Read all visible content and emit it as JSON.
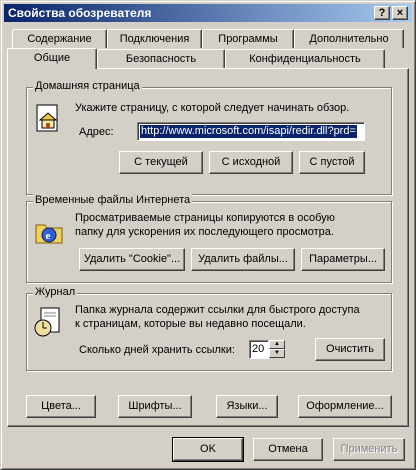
{
  "window": {
    "title": "Свойства обозревателя",
    "help": "?",
    "close": "×"
  },
  "tabs": {
    "row1": [
      "Содержание",
      "Подключения",
      "Программы",
      "Дополнительно"
    ],
    "row2": [
      "Общие",
      "Безопасность",
      "Конфиденциальность"
    ]
  },
  "home": {
    "legend": "Домашняя страница",
    "desc": "Укажите страницу, с которой следует начинать обзор.",
    "address_label": "Адрес:",
    "address_value": "http://www.microsoft.com/isapi/redir.dll?prd=",
    "btn_current": "С текущей",
    "btn_default": "С исходной",
    "btn_blank": "С пустой"
  },
  "temp": {
    "legend": "Временные файлы Интернета",
    "desc1": "Просматриваемые страницы копируются в особую",
    "desc2": "папку для ускорения их последующего просмотра.",
    "btn_cookies": "Удалить \"Cookie\"...",
    "btn_files": "Удалить файлы...",
    "btn_settings": "Параметры..."
  },
  "history": {
    "legend": "Журнал",
    "desc1": "Папка журнала содержит ссылки для быстрого доступа",
    "desc2": "к страницам, которые вы недавно посещали.",
    "days_label": "Сколько дней хранить ссылки:",
    "days_value": "20",
    "btn_clear": "Очистить"
  },
  "bottom": {
    "colors": "Цвета...",
    "fonts": "Шрифты...",
    "languages": "Языки...",
    "design": "Оформление..."
  },
  "dialog": {
    "ok": "OK",
    "cancel": "Отмена",
    "apply": "Применить"
  }
}
